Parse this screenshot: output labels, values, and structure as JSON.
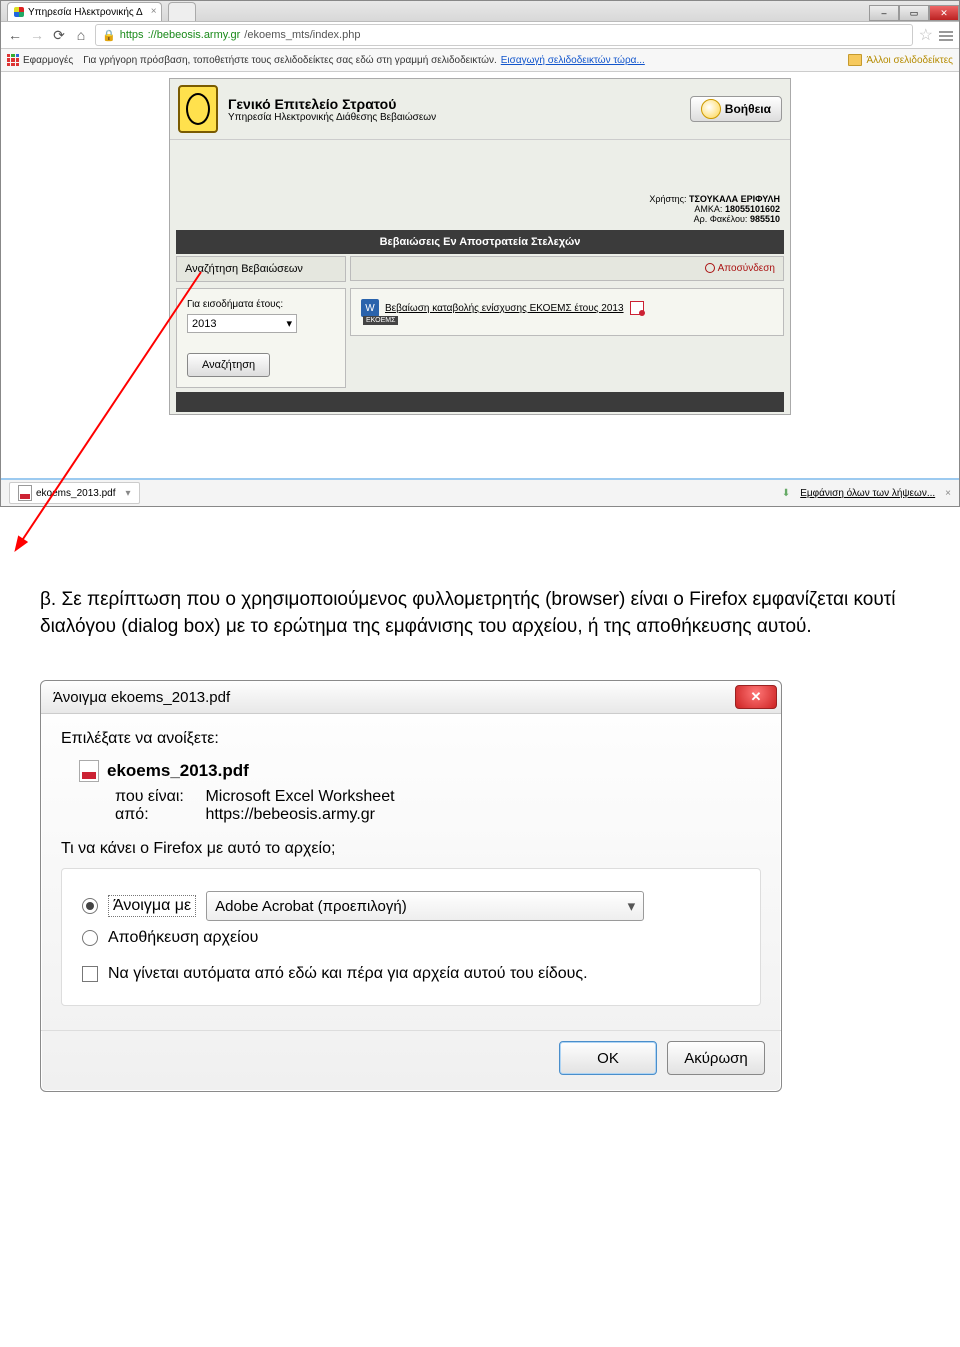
{
  "browser": {
    "tab1_title": "Υπηρεσία Ηλεκτρονικής Δ",
    "tab2_title": "",
    "url_https": "https",
    "url_host": "://bebeosis.army.gr",
    "url_path": "/ekoems_mts/index.php",
    "apps_label": "Εφαρμογές",
    "bk_text": "Για γρήγορη πρόσβαση, τοποθετήστε τους σελιδοδείκτες σας εδώ στη γραμμή σελιδοδεικτών.",
    "bk_link": "Εισαγωγή σελιδοδεικτών τώρα...",
    "other_bk": "Άλλοι σελιδοδείκτες"
  },
  "site": {
    "title": "Γενικό Επιτελείο Στρατού",
    "subtitle": "Υπηρεσία Ηλεκτρονικής Διάθεσης Βεβαιώσεων",
    "help": "Βοήθεια",
    "user_label": "Χρήστης:",
    "user_name": "ΤΣΟΥΚΑΛΑ ΕΡΙΦΥΛΗ",
    "amka_label": "ΑΜΚΑ:",
    "amka_val": "18055101602",
    "fak_label": "Αρ. Φακέλου:",
    "fak_val": "985510",
    "section_title": "Βεβαιώσεις Εν Αποστρατεία Στελεχών",
    "search_head": "Αναζήτηση Βεβαιώσεων",
    "logout": "Αποσύνδεση",
    "year_label": "Για εισοδήματα έτους:",
    "year_val": "2013",
    "search_btn": "Αναζήτηση",
    "doc_link": "Βεβαίωση καταβολής ενίσχυσης ΕΚΟΕΜΣ έτους 2013",
    "doc_badge": "ΕΚΟΕΜΣ"
  },
  "download": {
    "file": "ekoems_2013.pdf",
    "show_all": "Εμφάνιση όλων των λήψεων..."
  },
  "bodytext": "β.    Σε περίπτωση που ο χρησιμοποιούμενος φυλλομετρητής (browser) είναι ο Firefox εμφανίζεται κουτί διαλόγου (dialog box) με το ερώτημα της εμφάνισης του αρχείου, ή της αποθήκευσης αυτού.",
  "dialog": {
    "title": "Άνοιγμα ekoems_2013.pdf",
    "line1": "Επιλέξατε να ανοίξετε:",
    "filename": "ekoems_2013.pdf",
    "type_label": "που είναι:",
    "type_val": "Microsoft Excel Worksheet",
    "from_label": "από:",
    "from_val": "https://bebeosis.army.gr",
    "question": "Τι να κάνει ο Firefox  με αυτό το αρχείο;",
    "open_with": "Άνοιγμα με",
    "app_choice": "Adobe Acrobat  (προεπιλογή)",
    "save": "Αποθήκευση αρχείου",
    "auto": "Να γίνεται αυτόματα από εδώ και πέρα για αρχεία αυτού του είδους.",
    "ok": "OK",
    "cancel": "Ακύρωση"
  }
}
